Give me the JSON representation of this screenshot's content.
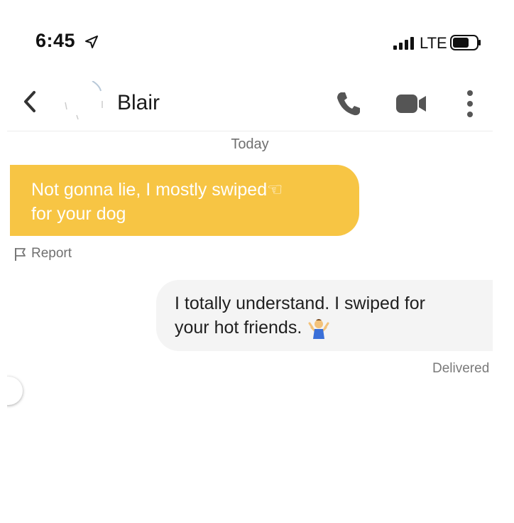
{
  "status_bar": {
    "time": "6:45",
    "network": "LTE",
    "icons": [
      "location-arrow-icon",
      "signal-bars-icon",
      "battery-icon"
    ]
  },
  "header": {
    "contact_name": "Blair",
    "icons": [
      "back-chevron-icon",
      "phone-icon",
      "video-camera-icon",
      "more-vertical-icon"
    ]
  },
  "conversation": {
    "date_label": "Today",
    "messages": [
      {
        "direction": "incoming",
        "text": "Not gonna lie, I mostly swiped☜",
        "text_line2": "for your dog",
        "bubble_color": "#f7c544"
      },
      {
        "direction": "outgoing",
        "text": "I totally understand. I swiped for",
        "text_line2": "your hot friends.",
        "bubble_color": "#f4f4f4"
      }
    ],
    "report_label": "Report",
    "delivered_label": "Delivered"
  }
}
